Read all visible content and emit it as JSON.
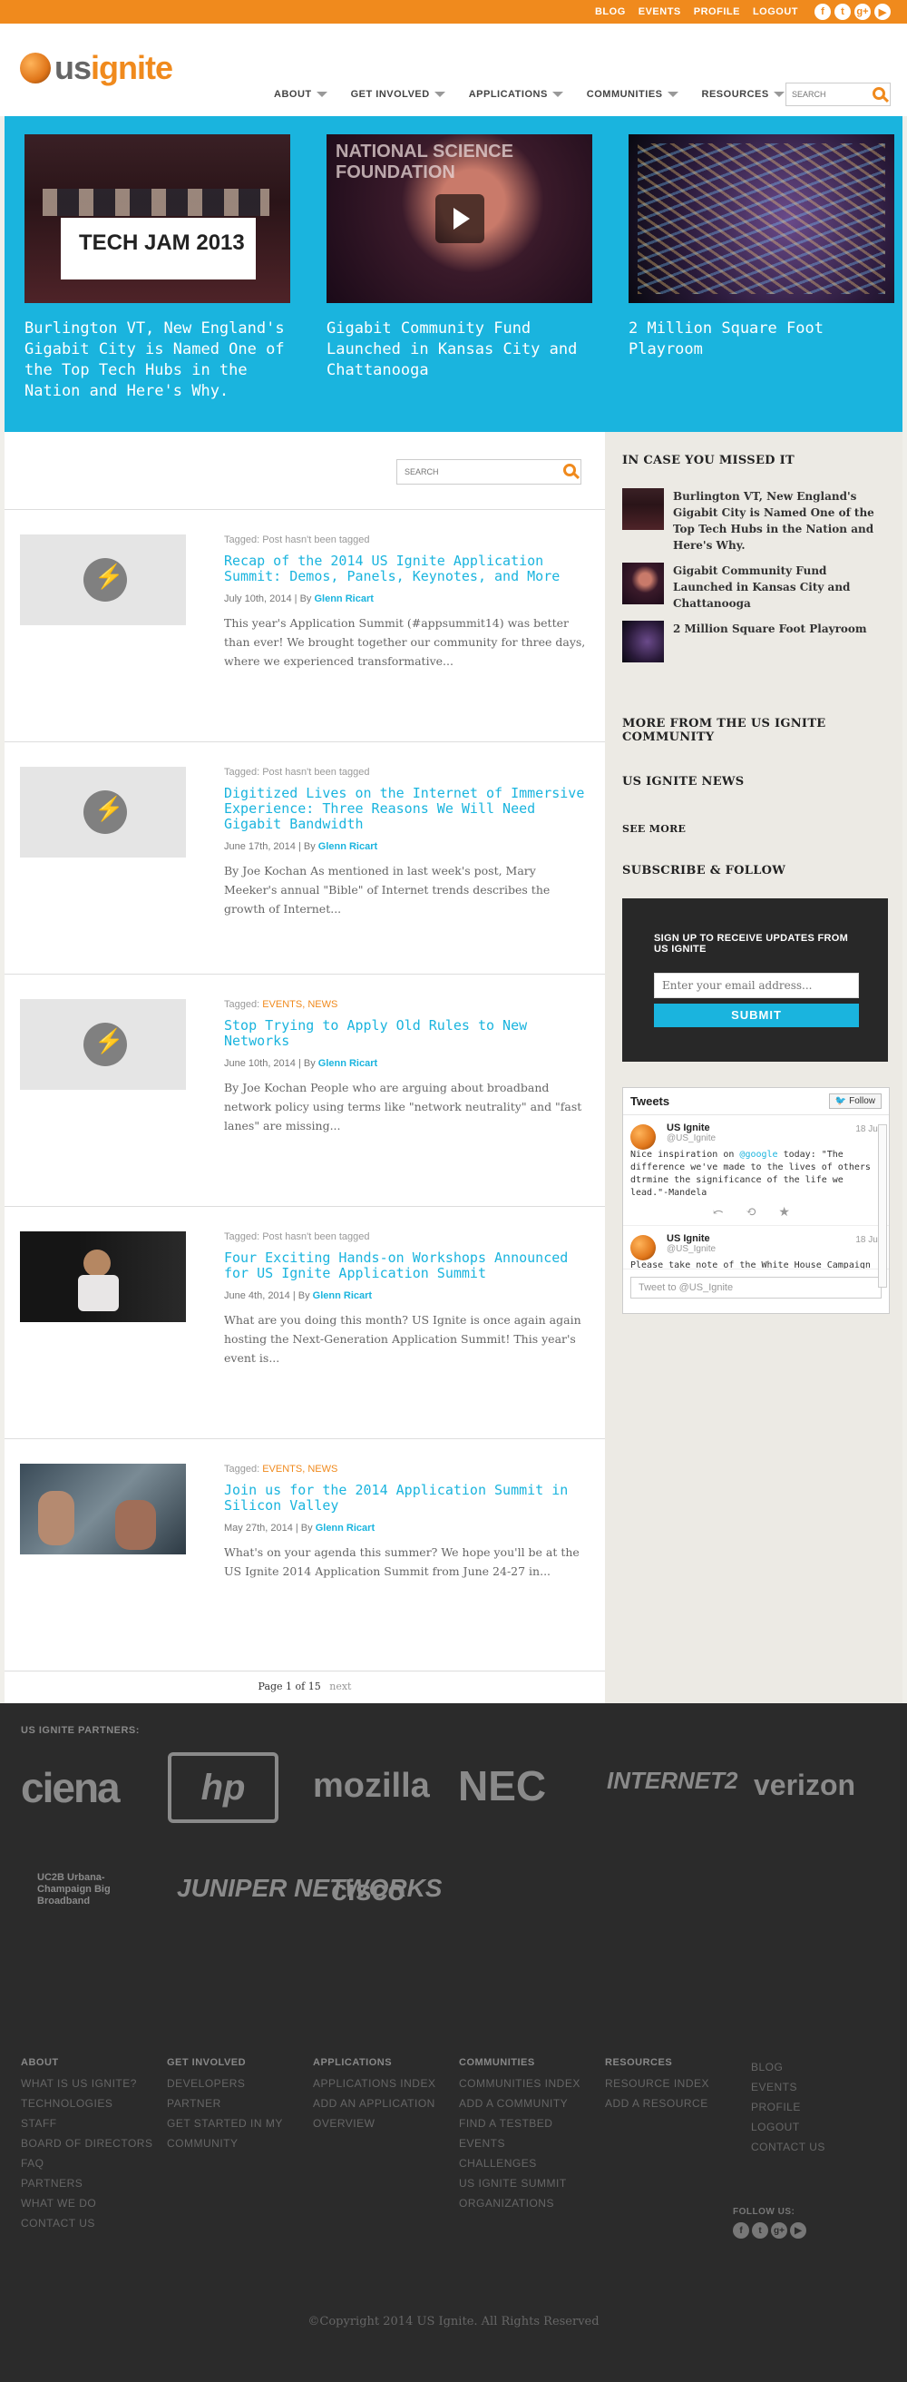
{
  "topbar": {
    "links": [
      "BLOG",
      "EVENTS",
      "PROFILE",
      "LOGOUT"
    ],
    "social_icons": [
      "facebook-icon",
      "twitter-icon",
      "google-plus-icon",
      "youtube-icon"
    ],
    "social_glyphs": [
      "f",
      "t",
      "g+",
      "▶"
    ]
  },
  "header": {
    "logo_us": "us",
    "logo_ignite": "ignite",
    "nav": [
      "ABOUT",
      "GET INVOLVED",
      "APPLICATIONS",
      "COMMUNITIES",
      "RESOURCES"
    ],
    "search_placeholder": "SEARCH"
  },
  "hero": {
    "items": [
      {
        "title": "Burlington VT, New England's Gigabit City is Named One of the Top Tech Hubs in the Nation and Here's Why.",
        "image_text": "TECH JAM 2013"
      },
      {
        "title": "Gigabit Community Fund Launched in Kansas City and Chattanooga",
        "image_text": "NATIONAL SCIENCE FOUNDATION"
      },
      {
        "title": "2 Million Square Foot Playroom"
      }
    ]
  },
  "content": {
    "search_placeholder": "SEARCH",
    "posts": [
      {
        "tagged_label": "Tagged:",
        "tags": "Post hasn't been tagged",
        "title": "Recap of the 2014 US Ignite Application Summit: Demos, Panels, Keynotes, and More",
        "date": "July 10th, 2014 | By ",
        "author": "Glenn Ricart",
        "excerpt": "This year's Application Summit (#appsummit14) was better than ever! We brought together our community for three days, where we experienced transformative..."
      },
      {
        "tagged_label": "Tagged:",
        "tags": "Post hasn't been tagged",
        "title": "Digitized Lives on the Internet of Immersive Experience: Three Reasons We Will Need Gigabit Bandwidth",
        "date": "June 17th, 2014 | By ",
        "author": "Glenn Ricart",
        "excerpt": "By Joe Kochan As mentioned in last week's post, Mary Meeker's annual \"Bible\" of Internet trends describes the growth of Internet..."
      },
      {
        "tagged_label": "Tagged:",
        "tags": "EVENTS, NEWS",
        "title": "Stop Trying to Apply Old Rules to New Networks",
        "date": "June 10th, 2014 | By ",
        "author": "Glenn Ricart",
        "excerpt": "By Joe Kochan People who are arguing about broadband network policy using terms like \"network neutrality\" and \"fast lanes\" are missing..."
      },
      {
        "tagged_label": "Tagged:",
        "tags": "Post hasn't been tagged",
        "title": "Four Exciting Hands-on Workshops Announced for US Ignite Application Summit",
        "date": "June 4th, 2014 | By ",
        "author": "Glenn Ricart",
        "excerpt": "What are you doing this month? US Ignite is once again again hosting the Next-Generation Application Summit! This year's event is..."
      },
      {
        "tagged_label": "Tagged:",
        "tags": "EVENTS, NEWS",
        "title": "Join us for the 2014 Application Summit in Silicon Valley",
        "date": "May 27th, 2014 | By ",
        "author": "Glenn Ricart",
        "excerpt": "What's on your agenda this summer? We hope you'll be at the US Ignite 2014 Application Summit from June 24-27 in..."
      }
    ],
    "pager": "Page 1 of 15",
    "pager_next": "next"
  },
  "sidebar": {
    "missed_heading": "IN CASE YOU MISSED IT",
    "missed": [
      "Burlington VT, New England's Gigabit City is Named One of the Top Tech Hubs in the Nation and Here's Why.",
      "Gigabit Community Fund Launched in Kansas City and Chattanooga",
      "2 Million Square Foot Playroom"
    ],
    "more_heading": "MORE FROM THE US IGNITE COMMUNITY",
    "news_heading": "US IGNITE NEWS",
    "see_more": "SEE MORE",
    "subscribe_heading": "SUBSCRIBE & FOLLOW",
    "signup_text": "SIGN UP TO RECEIVE UPDATES FROM US IGNITE",
    "email_placeholder": "Enter your email address...",
    "submit": "SUBMIT",
    "tweets": {
      "title": "Tweets",
      "follow": "Follow",
      "items": [
        {
          "name": "US Ignite",
          "handle": "@US_Ignite",
          "date": "18 Jul",
          "text_pre": "Nice inspiration on ",
          "mention": "@google",
          "text_post": " today: \"The difference we've made to the lives of others dtrmine the significance of the life we lead.\"-Mandela",
          "actions": "⤺ ⟲ ★"
        },
        {
          "name": "US Ignite",
          "handle": "@US_Ignite",
          "date": "18 Jul",
          "text_pre": "Please take note of the White House Campaign for Digital Progress and...",
          "mention": "",
          "text_post": ""
        }
      ],
      "input_placeholder": "Tweet to @US_Ignite"
    }
  },
  "footer": {
    "partners_heading": "US IGNITE PARTNERS:",
    "partners": [
      "ciena",
      "hp",
      "mozilla",
      "NEC",
      "INTERNET2",
      "verizon",
      "UC2B Urbana-Champaign Big Broadband",
      "JUNIPER NETWORKS",
      "cisco"
    ],
    "columns": [
      {
        "heading": "ABOUT",
        "links": [
          "WHAT IS US IGNITE?",
          "TECHNOLOGIES",
          "STAFF",
          "BOARD OF DIRECTORS",
          "FAQ",
          "PARTNERS",
          "WHAT WE DO",
          "CONTACT US"
        ]
      },
      {
        "heading": "GET INVOLVED",
        "links": [
          "DEVELOPERS",
          "PARTNER",
          "GET STARTED IN MY COMMUNITY"
        ]
      },
      {
        "heading": "APPLICATIONS",
        "links": [
          "APPLICATIONS INDEX",
          "ADD AN APPLICATION",
          "OVERVIEW"
        ]
      },
      {
        "heading": "COMMUNITIES",
        "links": [
          "COMMUNITIES INDEX",
          "ADD A COMMUNITY",
          "FIND A TESTBED",
          "EVENTS",
          "CHALLENGES",
          "US IGNITE SUMMIT",
          "ORGANIZATIONS"
        ]
      },
      {
        "heading": "RESOURCES",
        "links": [
          "RESOURCE INDEX",
          "ADD A RESOURCE"
        ]
      },
      {
        "heading": "",
        "links": [
          "BLOG",
          "EVENTS",
          "PROFILE",
          "LOGOUT",
          "CONTACT US"
        ]
      }
    ],
    "follow_us": "FOLLOW US:",
    "copyright": "©Copyright 2014 US Ignite. All Rights Reserved"
  }
}
